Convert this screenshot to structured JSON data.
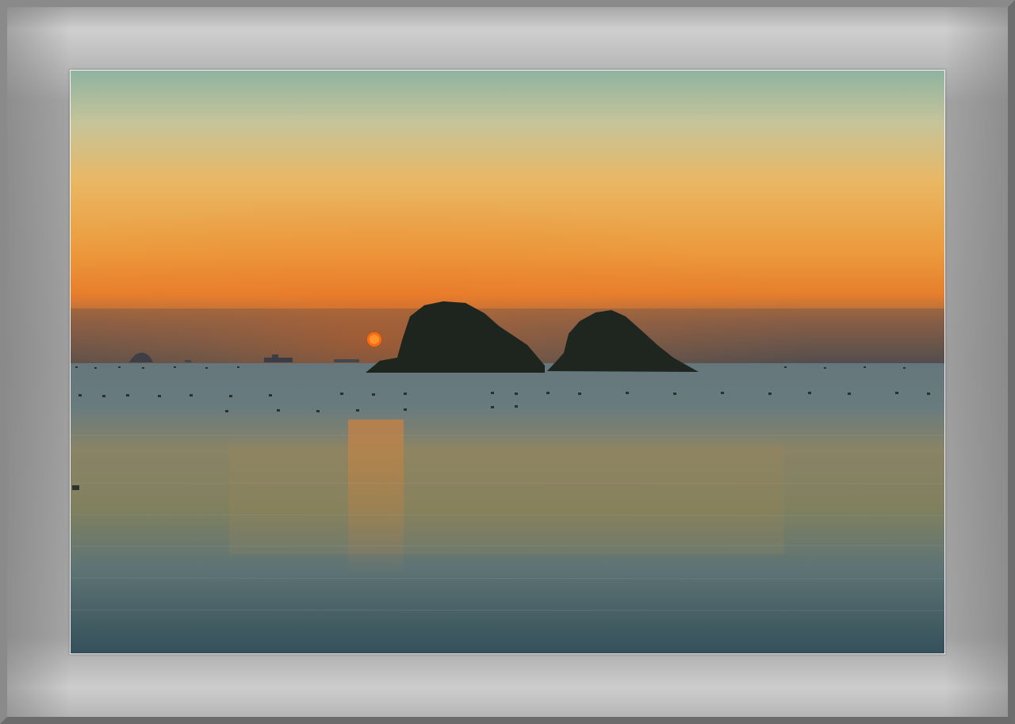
{
  "scene": {
    "subject": "sunset-over-sea-with-two-islands",
    "colors": {
      "sky_top": "#8fb3a0",
      "sky_mid": "#e6b765",
      "sky_horizon": "#e8862a",
      "haze": "#6a5a50",
      "sea": "#5e7779",
      "sun": "#ff6a10",
      "island": "#1e241e",
      "frame": "#a0a0a0"
    }
  }
}
